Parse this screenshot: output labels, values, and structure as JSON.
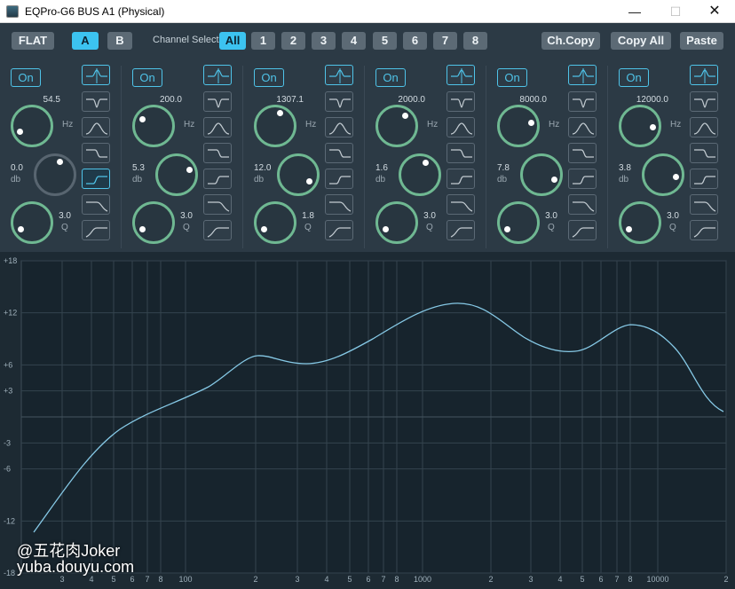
{
  "window": {
    "title": "EQPro-G6 BUS A1 (Physical)",
    "min_glyph": "—",
    "max_glyph": "☐",
    "close_glyph": "✕"
  },
  "toolbar": {
    "flat": "FLAT",
    "a": "A",
    "b": "B",
    "channel_select_label": "Channel Select:",
    "channels": [
      "All",
      "1",
      "2",
      "3",
      "4",
      "5",
      "6",
      "7",
      "8"
    ],
    "active_channel": "All",
    "active_ab": "A",
    "ch_copy": "Ch.Copy",
    "copy_all": "Copy All",
    "paste": "Paste"
  },
  "bands": [
    {
      "on": "On",
      "freq": "54.5",
      "freq_unit": "Hz",
      "gain": "0.0",
      "gain_unit": "db",
      "q": "3.0",
      "q_unit": "Q",
      "type_index": 4,
      "enabled": false
    },
    {
      "on": "On",
      "freq": "200.0",
      "freq_unit": "Hz",
      "gain": "5.3",
      "gain_unit": "db",
      "q": "3.0",
      "q_unit": "Q",
      "type_index": 0,
      "enabled": true
    },
    {
      "on": "On",
      "freq": "1307.1",
      "freq_unit": "Hz",
      "gain": "12.0",
      "gain_unit": "db",
      "q": "1.8",
      "q_unit": "Q",
      "type_index": 0,
      "enabled": true
    },
    {
      "on": "On",
      "freq": "2000.0",
      "freq_unit": "Hz",
      "gain": "1.6",
      "gain_unit": "db",
      "q": "3.0",
      "q_unit": "Q",
      "type_index": 0,
      "enabled": true
    },
    {
      "on": "On",
      "freq": "8000.0",
      "freq_unit": "Hz",
      "gain": "7.8",
      "gain_unit": "db",
      "q": "3.0",
      "q_unit": "Q",
      "type_index": 0,
      "enabled": true
    },
    {
      "on": "On",
      "freq": "12000.0",
      "freq_unit": "Hz",
      "gain": "3.8",
      "gain_unit": "db",
      "q": "3.0",
      "q_unit": "Q",
      "type_index": 0,
      "enabled": true
    }
  ],
  "filter_types": [
    "peak-icon",
    "notch-icon",
    "bandpass-icon",
    "high-shelf-icon",
    "low-shelf-icon",
    "low-pass-icon",
    "high-pass-icon"
  ],
  "graph": {
    "y_ticks": [
      "+18",
      "+12",
      "+6",
      "+3",
      "-3",
      "-6",
      "-12",
      "-18"
    ],
    "x_ticks": [
      "3",
      "4",
      "5",
      "6",
      "7",
      "8",
      "100",
      "2",
      "3",
      "4",
      "5",
      "6",
      "7",
      "8",
      "1000",
      "2",
      "3",
      "4",
      "5",
      "6",
      "7",
      "8",
      "10000",
      "2"
    ],
    "curve_color": "#86c9e6",
    "accent": "#3cc3f0"
  },
  "watermark": {
    "line1": "@五花肉Joker",
    "line2": "yuba.douyu.com"
  }
}
